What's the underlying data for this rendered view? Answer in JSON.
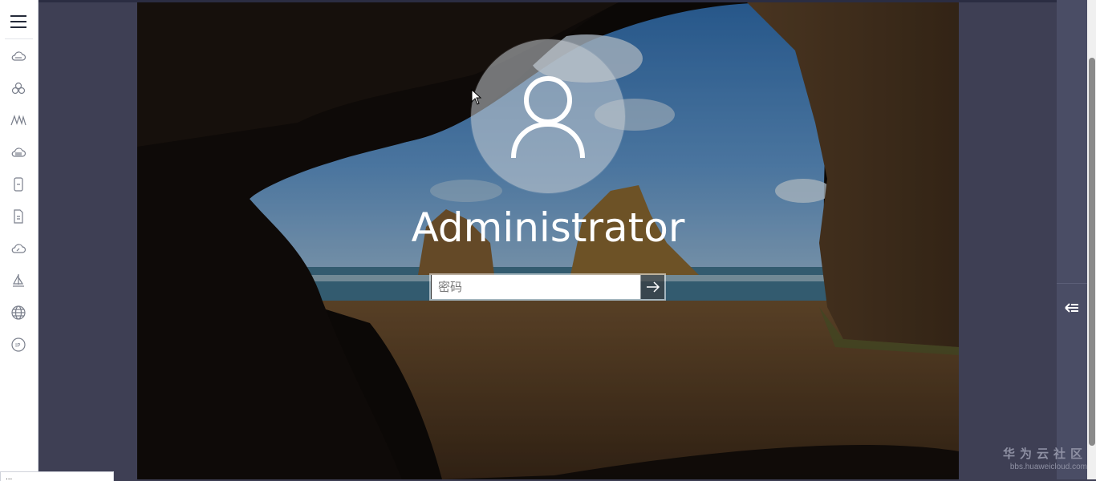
{
  "remote_login": {
    "username": "Administrator",
    "password_placeholder": "密码"
  },
  "nav": {
    "icons": [
      "cloud-icon",
      "cluster-icon",
      "mountain-icon",
      "cloud-database-icon",
      "document-icon",
      "file-icon",
      "cloud-speed-icon",
      "sail-icon",
      "globe-icon",
      "ip-icon"
    ]
  },
  "bottom_tip": "...",
  "watermark": {
    "main": "华为云社区",
    "sub": "bbs.huaweicloud.com"
  },
  "colors": {
    "sidebar_bg": "#ffffff",
    "page_bg": "#3e3f54",
    "right_rail": "#4a4d65",
    "nav_icon": "#7a7f8c"
  }
}
